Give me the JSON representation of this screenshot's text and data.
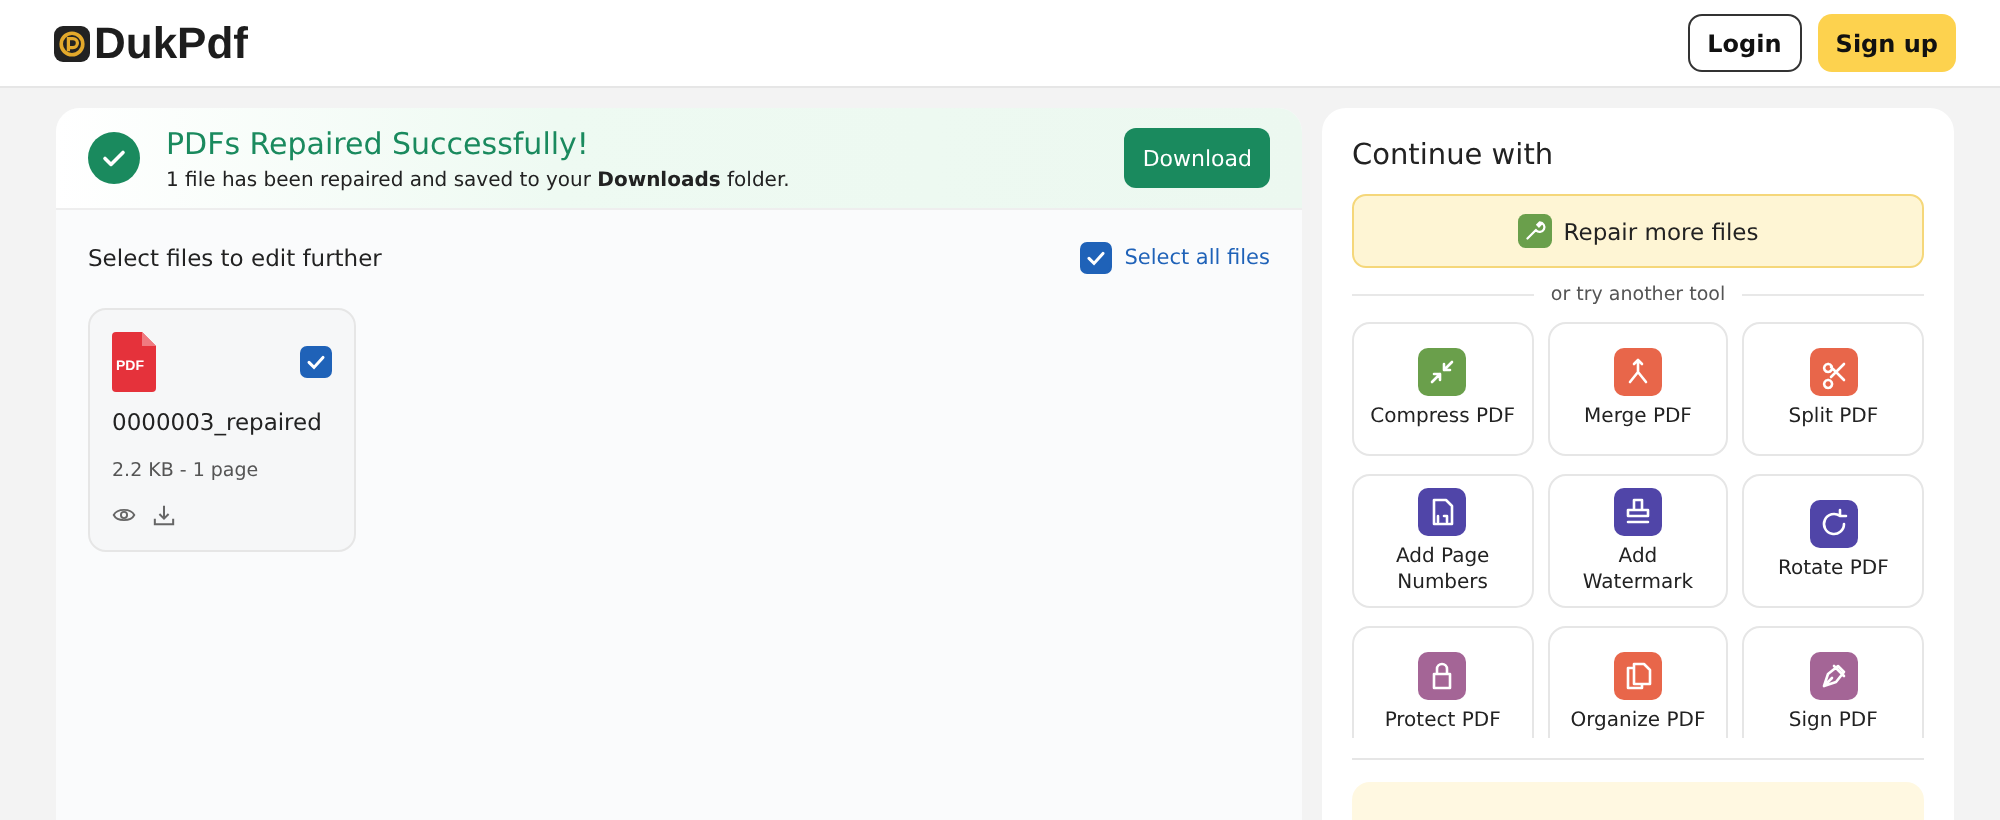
{
  "header": {
    "logo": "DukPdf",
    "buttons": [
      {
        "label": "Login",
        "kind": "outline"
      },
      {
        "label": "Sign up",
        "kind": "primary"
      }
    ]
  },
  "banner": {
    "title": "PDFs Repaired Successfully!",
    "message": "1 file has been repaired and saved to your **Downloads** folder.",
    "button": "Download"
  },
  "files_section": {
    "heading": "Select files to edit further",
    "select_all": {
      "label": "Select all files",
      "checked": true
    },
    "files": [
      {
        "name": "0000003_repaired",
        "meta": "2.2 KB - 1 page",
        "badge": "PDF",
        "checked": true
      }
    ]
  },
  "continue": {
    "title": "Continue with",
    "primary": "Repair more files",
    "divider": "or try another tool",
    "tools": [
      {
        "label": "Compress PDF",
        "kind": "compress",
        "color": "#6a9f4b"
      },
      {
        "label": "Merge PDF",
        "kind": "merge",
        "color": "#e8664a"
      },
      {
        "label": "Split PDF",
        "kind": "split",
        "color": "#e8664a"
      },
      {
        "label": "Add Page Numbers",
        "kind": "numbers",
        "color": "#5045a8"
      },
      {
        "label": "Add Watermark",
        "kind": "stamp",
        "color": "#5045a8"
      },
      {
        "label": "Rotate PDF",
        "kind": "rotate",
        "color": "#5045a8"
      },
      {
        "label": "Protect PDF",
        "kind": "lock",
        "color": "#a46596"
      },
      {
        "label": "Organize PDF",
        "kind": "pages",
        "color": "#e8664a"
      },
      {
        "label": "Sign PDF",
        "kind": "pen",
        "color": "#a46596"
      }
    ]
  }
}
